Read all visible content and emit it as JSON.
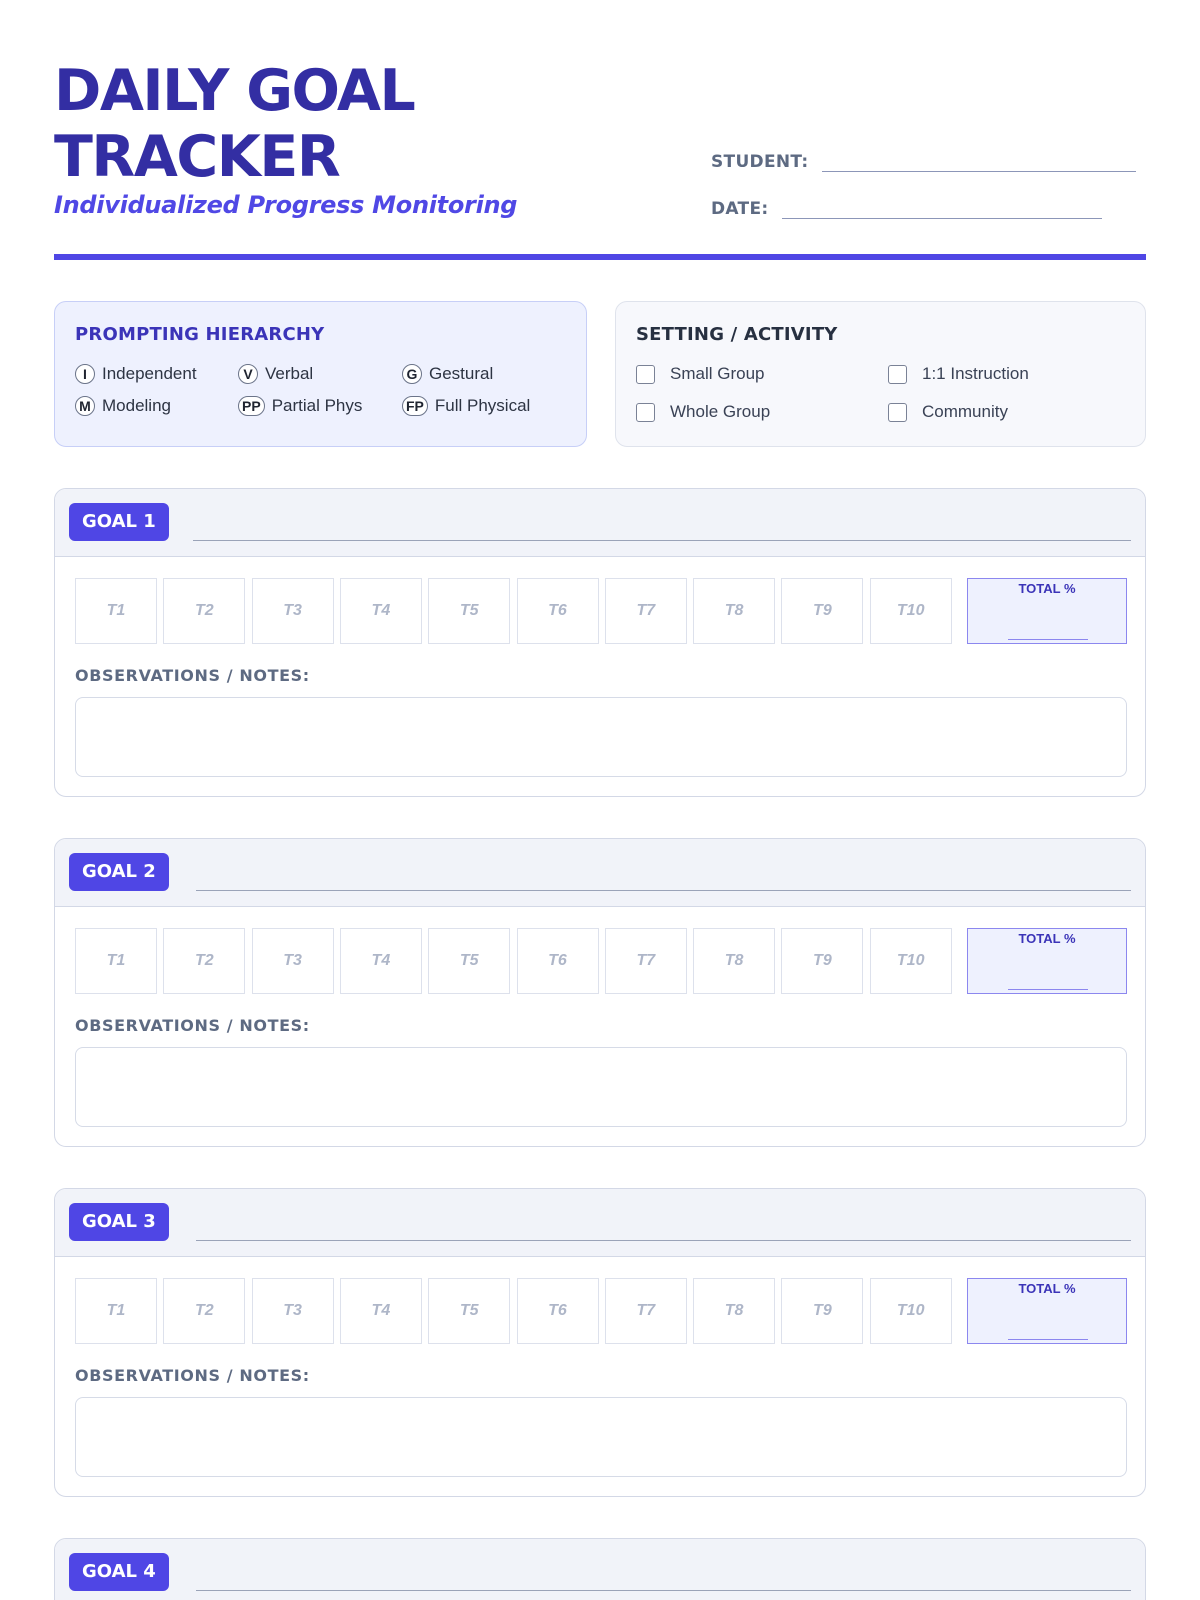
{
  "header": {
    "title_line1": "DAILY GOAL",
    "title_line2": "TRACKER",
    "subtitle": "Individualized Progress Monitoring",
    "student_label": "STUDENT:",
    "date_label": "DATE:"
  },
  "prompting": {
    "title": "PROMPTING HIERARCHY",
    "items": [
      {
        "code": "I",
        "label": "Independent"
      },
      {
        "code": "V",
        "label": "Verbal"
      },
      {
        "code": "G",
        "label": "Gestural"
      },
      {
        "code": "M",
        "label": "Modeling"
      },
      {
        "code": "PP",
        "label": "Partial Phys"
      },
      {
        "code": "FP",
        "label": "Full Physical"
      }
    ]
  },
  "setting": {
    "title": "SETTING / ACTIVITY",
    "options": [
      {
        "label": "Small Group",
        "checked": false
      },
      {
        "label": "1:1 Instruction",
        "checked": false
      },
      {
        "label": "Whole Group",
        "checked": false
      },
      {
        "label": "Community",
        "checked": false
      }
    ]
  },
  "trial_labels": [
    "T1",
    "T2",
    "T3",
    "T4",
    "T5",
    "T6",
    "T7",
    "T8",
    "T9",
    "T10"
  ],
  "total_label": "TOTAL %",
  "notes_label": "OBSERVATIONS / NOTES:",
  "goals": [
    {
      "label": "GOAL 1"
    },
    {
      "label": "GOAL 2"
    },
    {
      "label": "GOAL 3"
    },
    {
      "label": "GOAL 4"
    }
  ],
  "colors": {
    "accent": "#4f46e5",
    "title": "#332ea3",
    "panel_tint": "#eef1fe"
  }
}
